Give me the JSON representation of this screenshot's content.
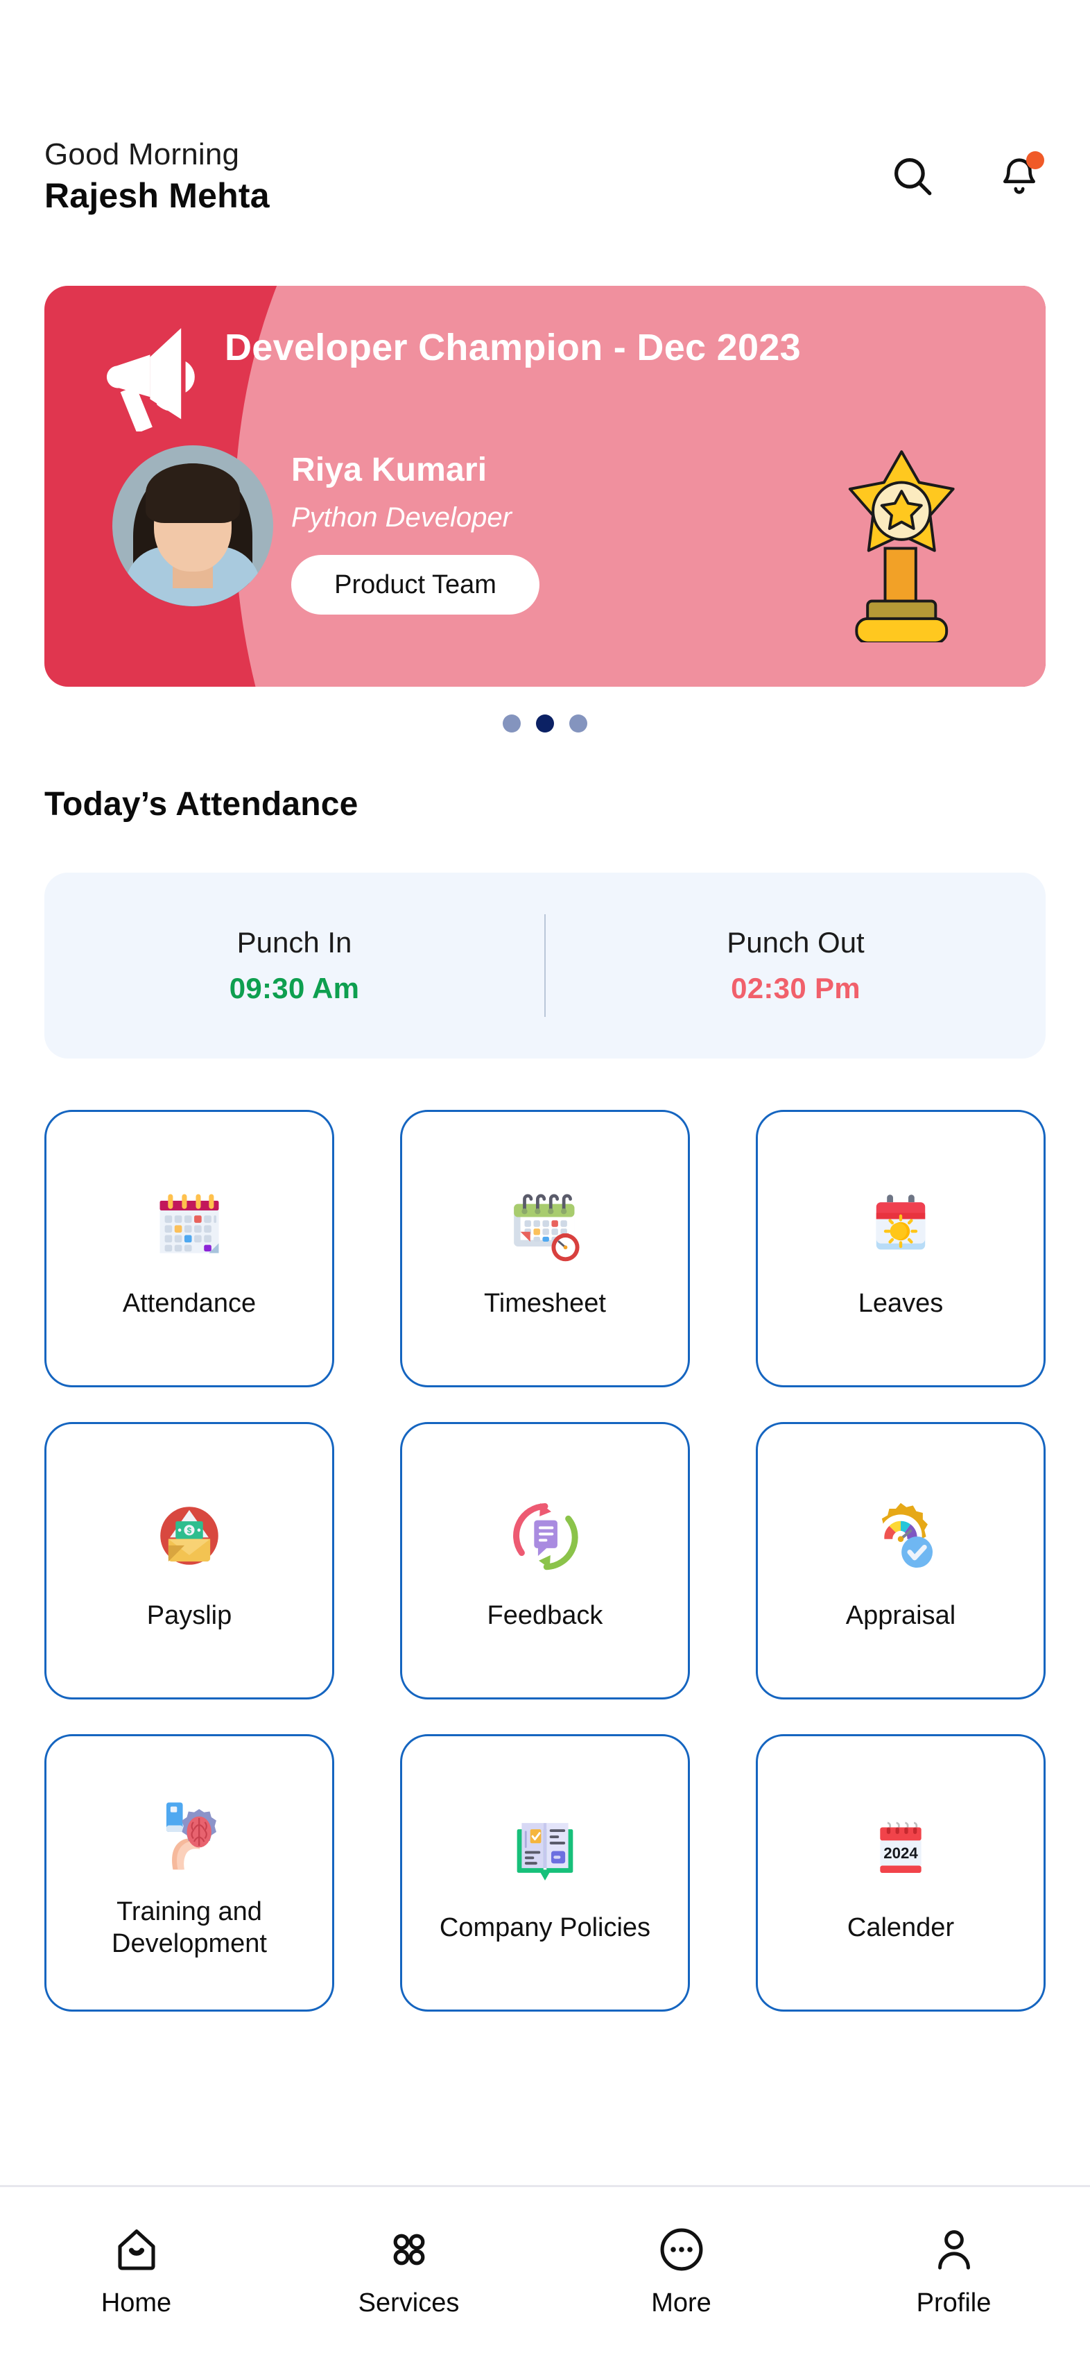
{
  "header": {
    "greeting": "Good Morning",
    "username": "Rajesh Mehta",
    "search_icon": "search-icon",
    "notification_icon": "bell-icon",
    "has_notification": true
  },
  "banner": {
    "title": "Developer Champion - Dec 2023",
    "employee_name": "Riya Kumari",
    "employee_role": "Python Developer",
    "team_label": "Product  Team",
    "megaphone_icon": "megaphone-icon",
    "trophy_icon": "star-trophy-icon",
    "bg_color": "#E0364F",
    "accent_color": "#F0909E"
  },
  "carousel": {
    "total": 3,
    "active_index": 1,
    "active_color": "#0B2164",
    "inactive_color": "#8494BE"
  },
  "attendance": {
    "section_title": "Today’s Attendance",
    "punch_in_label": "Punch In",
    "punch_in_time": "09:30 Am",
    "punch_in_color": "#0E9F4F",
    "punch_out_label": "Punch Out",
    "punch_out_time": "02:30 Pm",
    "punch_out_color": "#F1606B"
  },
  "services": [
    {
      "label": "Attendance",
      "icon": "calendar-grid-icon"
    },
    {
      "label": "Timesheet",
      "icon": "calendar-stopwatch-icon"
    },
    {
      "label": "Leaves",
      "icon": "calendar-sun-icon"
    },
    {
      "label": "Payslip",
      "icon": "money-envelope-icon"
    },
    {
      "label": "Feedback",
      "icon": "speech-bubble-refresh-icon"
    },
    {
      "label": "Appraisal",
      "icon": "gear-gauge-check-icon"
    },
    {
      "label": "Training and Development",
      "icon": "hand-brain-gear-icon"
    },
    {
      "label": "Company Policies",
      "icon": "open-book-icon"
    },
    {
      "label": "Calender",
      "icon": "desk-calendar-2024-icon"
    }
  ],
  "calendar_icon_year": "2024",
  "bottom_nav": [
    {
      "label": "Home",
      "icon": "home-icon"
    },
    {
      "label": "Services",
      "icon": "grid-dots-icon"
    },
    {
      "label": "More",
      "icon": "more-circle-icon"
    },
    {
      "label": "Profile",
      "icon": "person-icon"
    }
  ]
}
